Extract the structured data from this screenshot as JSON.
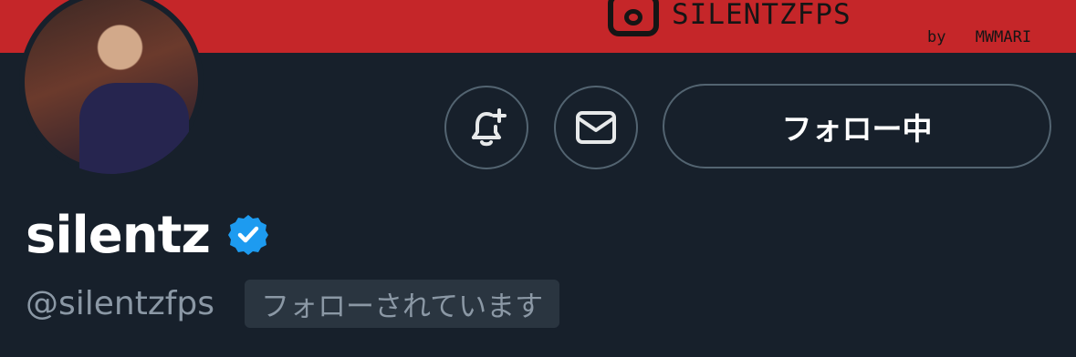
{
  "banner": {
    "handle_text": "SILENTZFPS",
    "credit_text": "by MWMARI",
    "color": "#c52629"
  },
  "profile": {
    "display_name": "silentz",
    "handle": "@silentzfps",
    "follows_you_badge": "フォローされています",
    "verified_color": "#1d9bf0"
  },
  "actions": {
    "notify_icon": "bell-plus-icon",
    "message_icon": "envelope-icon",
    "follow_label": "フォロー中"
  },
  "colors": {
    "background": "#17202b",
    "border": "#536471",
    "muted_text": "#8b98a5"
  }
}
